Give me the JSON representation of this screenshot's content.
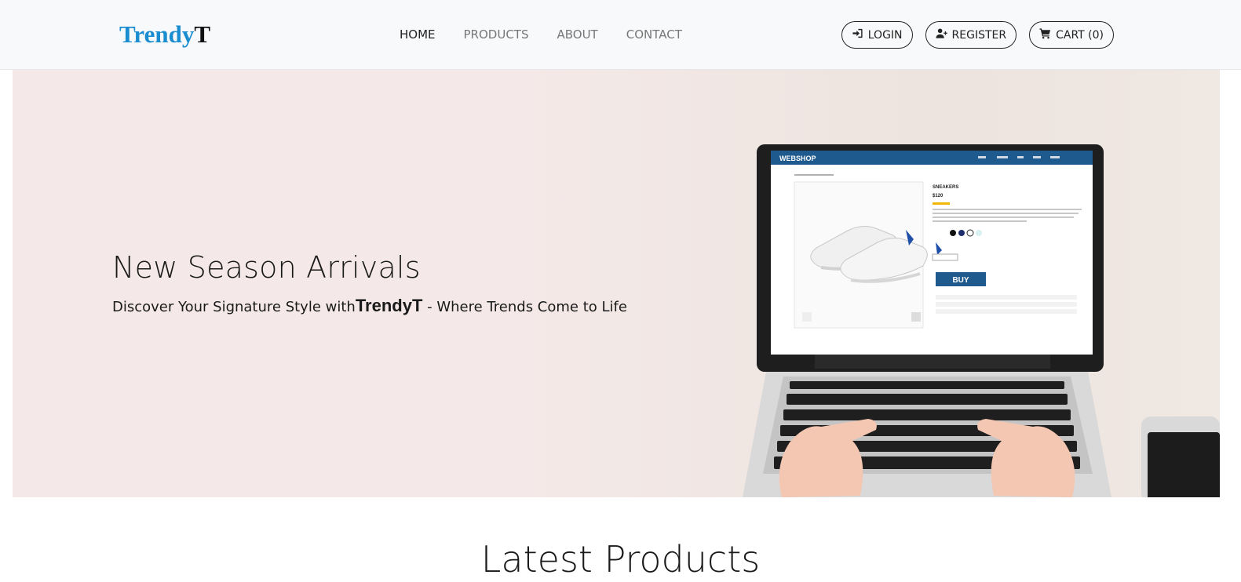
{
  "brand": {
    "part1": "Trendy",
    "part2": "T"
  },
  "nav": {
    "links": [
      {
        "label": "HOME",
        "active": true
      },
      {
        "label": "PRODUCTS",
        "active": false
      },
      {
        "label": "ABOUT",
        "active": false
      },
      {
        "label": "CONTACT",
        "active": false
      }
    ],
    "buttons": {
      "login": "LOGIN",
      "register": "REGISTER",
      "cart": "CART (0)"
    }
  },
  "hero": {
    "title": "New Season Arrivals",
    "subtitle_pre": "Discover Your Signature Style with",
    "subtitle_brand": "TrendyT",
    "subtitle_post": " - Where Trends Come to Life",
    "image": {
      "site_name": "WEBSHOP",
      "product_name": "SNEAKERS",
      "product_price": "$120",
      "buy_label": "BUY"
    }
  },
  "latest": {
    "title": "Latest Products"
  },
  "colors": {
    "navbar_bg": "#f8f9fa",
    "brand_blue": "#1a8cd0",
    "hero_bg": "#f4e9e8",
    "webshop_blue": "#1f5a8f"
  },
  "icons": {
    "login": "sign-in-icon",
    "register": "user-plus-icon",
    "cart": "shopping-cart-icon"
  }
}
